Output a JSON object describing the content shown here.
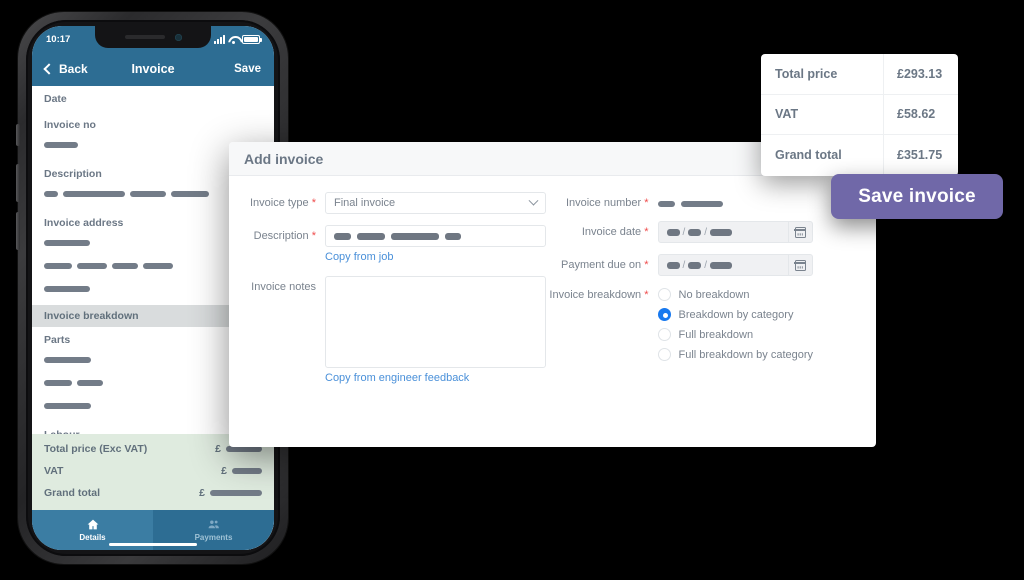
{
  "phone": {
    "status": {
      "time": "10:17",
      "signal_icon": "signal-bars-icon",
      "wifi_icon": "wifi-icon",
      "battery_icon": "battery-icon"
    },
    "nav": {
      "back_label": "Back",
      "title": "Invoice",
      "save_label": "Save"
    },
    "sections": [
      {
        "label": "Date",
        "bars": []
      },
      {
        "label": "Invoice no",
        "bars": [
          [
            34
          ]
        ]
      },
      {
        "label": "Description",
        "bars": [
          [
            14,
            62,
            36,
            38
          ]
        ]
      },
      {
        "label": "Invoice address",
        "bars": [
          [
            46
          ],
          [
            28,
            30,
            26,
            30
          ],
          [
            46
          ]
        ]
      }
    ],
    "band_label": "Invoice breakdown",
    "breakdown": [
      {
        "label": "Parts",
        "bars": [
          [
            47
          ],
          [
            28,
            26
          ],
          [
            47
          ]
        ]
      },
      {
        "label": "Labour",
        "bars": [
          [
            45
          ]
        ]
      }
    ],
    "totals": [
      {
        "label": "Total price (Exc VAT)",
        "currency": "£",
        "bar": 36
      },
      {
        "label": "VAT",
        "currency": "£",
        "bar": 30
      },
      {
        "label": "Grand total",
        "currency": "£",
        "bar": 52
      }
    ],
    "tabs": [
      {
        "label": "Details",
        "icon": "home-icon",
        "active": true
      },
      {
        "label": "Payments",
        "icon": "people-icon",
        "active": false
      }
    ]
  },
  "dialog": {
    "title": "Add invoice",
    "invoice_type": {
      "label": "Invoice type",
      "required": "*",
      "value": "Final invoice",
      "chevron_icon": "chevron-down-icon"
    },
    "description": {
      "label": "Description",
      "required": "*",
      "bars": [
        17,
        28,
        48,
        16
      ],
      "copy_link": "Copy from job"
    },
    "invoice_notes": {
      "label": "Invoice notes",
      "value": "",
      "copy_link": "Copy from engineer feedback"
    },
    "invoice_number": {
      "label": "Invoice number",
      "required": "*",
      "bars": [
        17,
        42
      ]
    },
    "invoice_date": {
      "label": "Invoice date",
      "required": "*",
      "bars": [
        13,
        13,
        22
      ],
      "separator": "/",
      "calendar_icon": "calendar-icon"
    },
    "payment_due_on": {
      "label": "Payment due on",
      "required": "*",
      "bars": [
        13,
        13,
        22
      ],
      "separator": "/",
      "calendar_icon": "calendar-icon"
    },
    "invoice_breakdown": {
      "label": "Invoice breakdown",
      "required": "*",
      "options": [
        {
          "label": "No breakdown",
          "selected": false
        },
        {
          "label": "Breakdown by category",
          "selected": true
        },
        {
          "label": "Full breakdown",
          "selected": false
        },
        {
          "label": "Full breakdown by category",
          "selected": false
        }
      ]
    }
  },
  "totals_card": {
    "rows": [
      {
        "label": "Total price",
        "value": "£293.13"
      },
      {
        "label": "VAT",
        "value": "£58.62"
      },
      {
        "label": "Grand total",
        "value": "£351.75"
      }
    ]
  },
  "save_pill": {
    "label": "Save invoice"
  },
  "colors": {
    "phone_header": "#2d6d93",
    "phone_tab_active": "#3b7da3",
    "totals_green": "#dfebdf",
    "link_blue": "#4a90d9",
    "radio_blue": "#1879ef",
    "pill_purple": "#7068a8",
    "required_red": "#ef4b4b",
    "redaction_gray": "#737c88",
    "background": "#000000"
  }
}
